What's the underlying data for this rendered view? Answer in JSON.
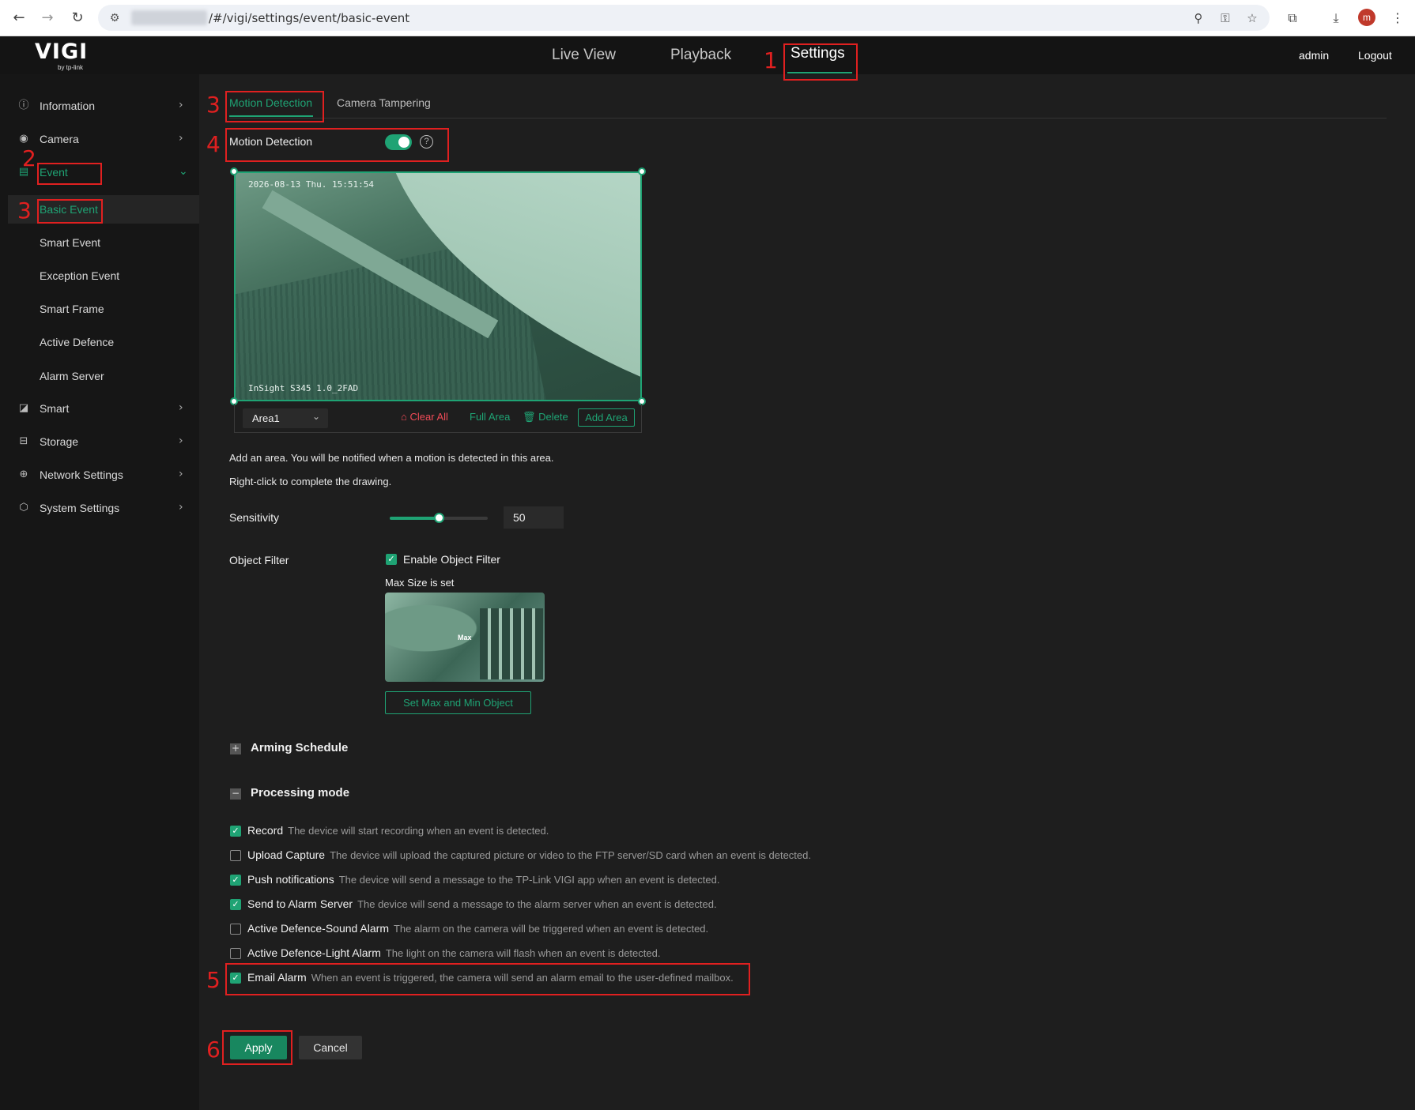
{
  "browser": {
    "url_path": "/#/vigi/settings/event/basic-event",
    "profile_initial": "m",
    "icons": [
      "back-arrow-icon",
      "forward-arrow-icon",
      "reload-icon",
      "site-info-icon",
      "zoom-icon",
      "password-key-icon",
      "bookmark-star-icon",
      "extensions-icon",
      "download-icon",
      "menu-dots-icon"
    ]
  },
  "header": {
    "logo": "VIGI",
    "logo_sub": "by tp-link",
    "tabs": [
      "Live View",
      "Playback",
      "Settings"
    ],
    "active_tab": "Settings",
    "user": "admin",
    "logout": "Logout"
  },
  "sidebar": {
    "items": [
      {
        "label": "Information",
        "icon": "info-icon"
      },
      {
        "label": "Camera",
        "icon": "camera-icon"
      },
      {
        "label": "Event",
        "icon": "event-icon"
      },
      {
        "label": "Smart",
        "icon": "smart-icon"
      },
      {
        "label": "Storage",
        "icon": "storage-icon"
      },
      {
        "label": "Network Settings",
        "icon": "globe-icon"
      },
      {
        "label": "System Settings",
        "icon": "settings-icon"
      }
    ],
    "event_sub_items": [
      "Basic Event",
      "Smart Event",
      "Exception Event",
      "Smart Frame",
      "Active Defence",
      "Alarm Server"
    ]
  },
  "annotations": [
    "1",
    "2",
    "3",
    "3",
    "4",
    "5",
    "6"
  ],
  "content": {
    "tabs": [
      "Motion Detection",
      "Camera Tampering"
    ],
    "motion_detection_label": "Motion Detection",
    "motion_detection_enabled": true,
    "video_timestamp": "2026-08-13 Thu. 15:51:54",
    "video_camera_name": "InSight S345 1.0_2FAD",
    "area_select": "Area1",
    "area_actions": {
      "clear_all": "Clear All",
      "full_area": "Full Area",
      "delete": "Delete",
      "add_area": "Add Area"
    },
    "hint_1": "Add an area. You will be notified when a motion is detected in this area.",
    "hint_2": "Right-click to complete the drawing.",
    "sensitivity_label": "Sensitivity",
    "sensitivity_value": "50",
    "sensitivity_fraction": 0.5,
    "object_filter_label": "Object Filter",
    "enable_object_filter": "Enable Object Filter",
    "max_size_text": "Max Size is set",
    "thumb_label": "Max",
    "set_max_min_button": "Set Max and Min Object",
    "arming_schedule": "Arming Schedule",
    "processing_mode": "Processing mode",
    "processing": [
      {
        "name": "Record",
        "desc": "The device will start recording when an event is detected.",
        "checked": true
      },
      {
        "name": "Upload Capture",
        "desc": "The device will upload the captured picture or video to the FTP server/SD card when an event is detected.",
        "checked": false
      },
      {
        "name": "Push notifications",
        "desc": "The device will send a message to the TP-Link VIGI app when an event is detected.",
        "checked": true
      },
      {
        "name": "Send to Alarm Server",
        "desc": "The device will send a message to the alarm server when an event is detected.",
        "checked": true
      },
      {
        "name": "Active Defence-Sound Alarm",
        "desc": "The alarm on the camera will be triggered when an event is detected.",
        "checked": false
      },
      {
        "name": "Active Defence-Light Alarm",
        "desc": "The light on the camera will flash when an event is detected.",
        "checked": false
      },
      {
        "name": "Email Alarm",
        "desc": "When an event is triggered, the camera will send an alarm email to the user-defined mailbox.",
        "checked": true
      }
    ],
    "apply": "Apply",
    "cancel": "Cancel"
  },
  "colors": {
    "accent": "#1fa374",
    "annotation": "#e02020",
    "danger": "#ef4b57"
  }
}
